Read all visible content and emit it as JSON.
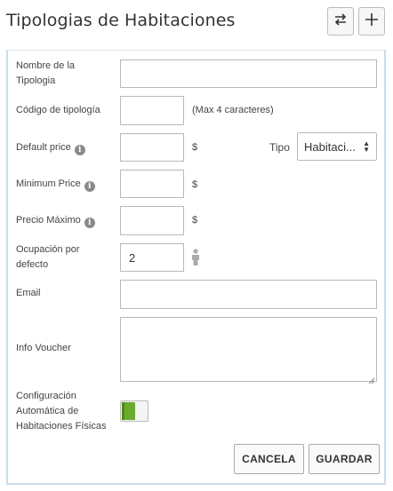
{
  "header": {
    "title": "Tipologias de Habitaciones",
    "buttons": [
      {
        "icon": "swap-arrows-icon"
      },
      {
        "icon": "plus-icon"
      }
    ]
  },
  "form": {
    "nombre": {
      "label": "Nombre de la Tipologia",
      "value": ""
    },
    "codigo": {
      "label": "Código de tipología",
      "value": "",
      "hint": "(Max 4 caracteres)"
    },
    "default_price": {
      "label": "Default price",
      "value": "",
      "currency": "$"
    },
    "tipo": {
      "label": "Tipo",
      "selected": "Habitaci..."
    },
    "minimum_price": {
      "label": "Minimum Price",
      "value": "",
      "currency": "$"
    },
    "precio_maximo": {
      "label": "Precio Máximo",
      "value": "",
      "currency": "$"
    },
    "ocupacion": {
      "label": "Ocupación por defecto",
      "value": "2"
    },
    "email": {
      "label": "Email",
      "value": ""
    },
    "info_voucher": {
      "label": "Info Voucher",
      "value": ""
    },
    "config_auto": {
      "label": "Configuración Automática de Habitaciones Físicas",
      "on": true
    }
  },
  "actions": {
    "cancel": "CANCELA",
    "save": "GUARDAR"
  },
  "colors": {
    "toggle_on": "#6aab2f",
    "panel_border": "#c9dcea"
  }
}
